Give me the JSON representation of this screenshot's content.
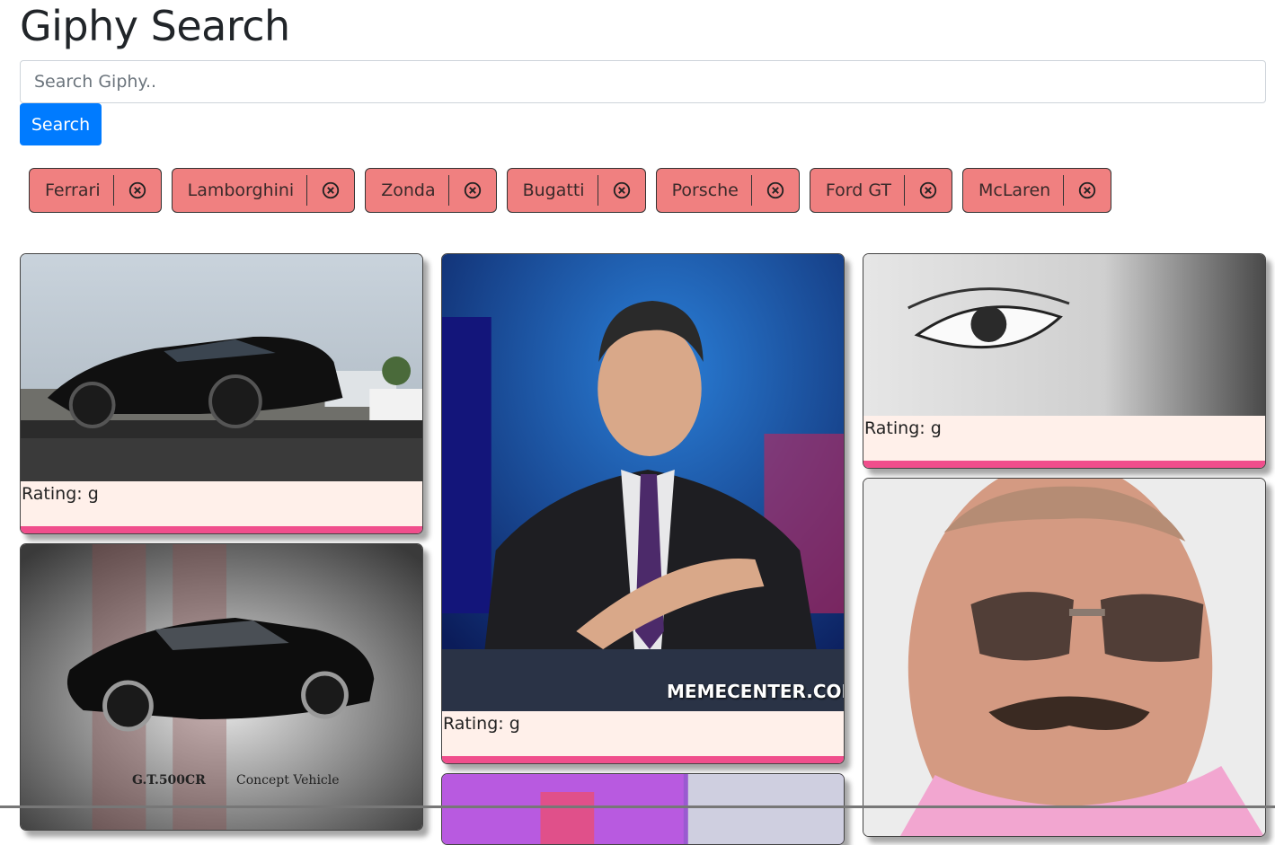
{
  "header": {
    "title": "Giphy Search"
  },
  "search": {
    "placeholder": "Search Giphy..",
    "value": "",
    "button_label": "Search"
  },
  "topics": [
    {
      "label": "Ferrari"
    },
    {
      "label": "Lamborghini"
    },
    {
      "label": "Zonda"
    },
    {
      "label": "Bugatti"
    },
    {
      "label": "Porsche"
    },
    {
      "label": "Ford GT"
    },
    {
      "label": "McLaren"
    }
  ],
  "gifs": [
    {
      "rating": "Rating: g",
      "alt": "black mustang on trailer",
      "watermark": ""
    },
    {
      "rating": "",
      "alt": "GT500CR concept vehicle",
      "caption": "G.T.500CR",
      "caption_sub": "Concept Vehicle"
    },
    {
      "rating": "Rating: g",
      "alt": "news anchor shrugging",
      "watermark": "MEMECENTER.COM"
    },
    {
      "rating": "",
      "alt": "purple studio"
    },
    {
      "rating": "Rating: g",
      "alt": "close-up eye black and white"
    },
    {
      "rating": "",
      "alt": "man with mustache and sunglasses"
    }
  ],
  "colors": {
    "accent": "#007bff",
    "chip": "#f08080",
    "card_bg": "#fff0ea",
    "card_bar": "#f04e8c"
  },
  "icons": {
    "remove": "circle-x-icon"
  }
}
